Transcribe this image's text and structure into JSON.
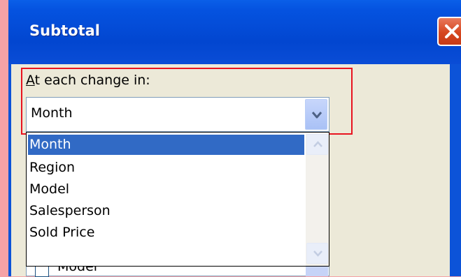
{
  "dialog": {
    "title": "Subtotal"
  },
  "group_by": {
    "label": "At each change in:",
    "selected_value": "Month",
    "options": [
      "Month",
      "Region",
      "Model",
      "Salesperson",
      "Sold Price"
    ],
    "highlighted_index": 0
  },
  "partially_hidden_row": {
    "text": "Model"
  },
  "icons": {
    "close": "close-icon",
    "combo_arrow": "chevron-down-icon",
    "scroll_up": "scroll-up-icon",
    "scroll_down": "scroll-down-icon"
  },
  "colors": {
    "titlebar": "#0553e0",
    "client": "#ece9d8",
    "highlight": "#316ac5",
    "annotation": "#e8131f",
    "close_button": "#d6461f"
  }
}
